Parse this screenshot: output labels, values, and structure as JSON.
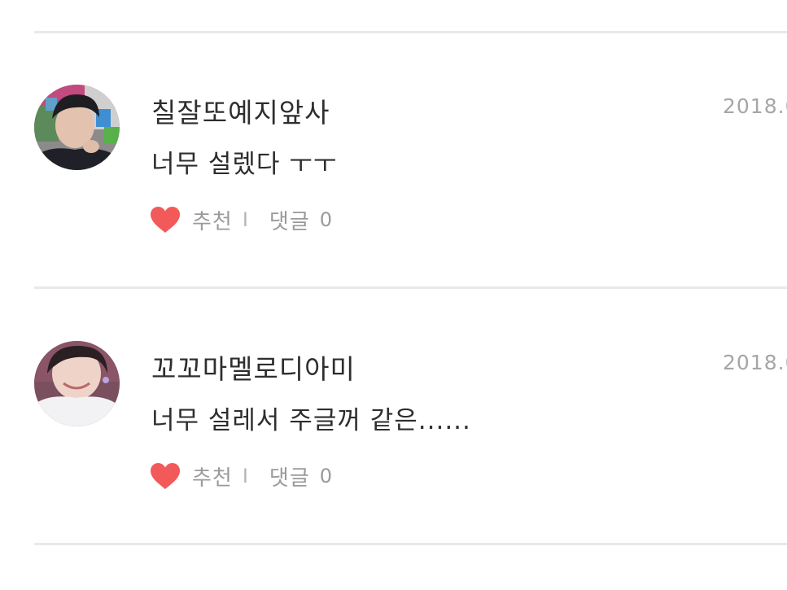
{
  "colors": {
    "heart": "#f25a5a",
    "divider": "#e9e9e9",
    "text": "#2e2e2e",
    "muted": "#9a9a9a"
  },
  "icons": {
    "like": "heart-icon"
  },
  "comments": [
    {
      "username": "칠잘또예지앞사",
      "date": "2018.0",
      "text": "너무 설렜다 ㅜㅜ",
      "like_label": "추천",
      "separator": "I",
      "reply_label": "댓글",
      "reply_count": "0"
    },
    {
      "username": "꼬꼬마멜로디아미",
      "date": "2018.0",
      "text": "너무 설레서 주글꺼 같은......",
      "like_label": "추천",
      "separator": "I",
      "reply_label": "댓글",
      "reply_count": "0"
    }
  ]
}
